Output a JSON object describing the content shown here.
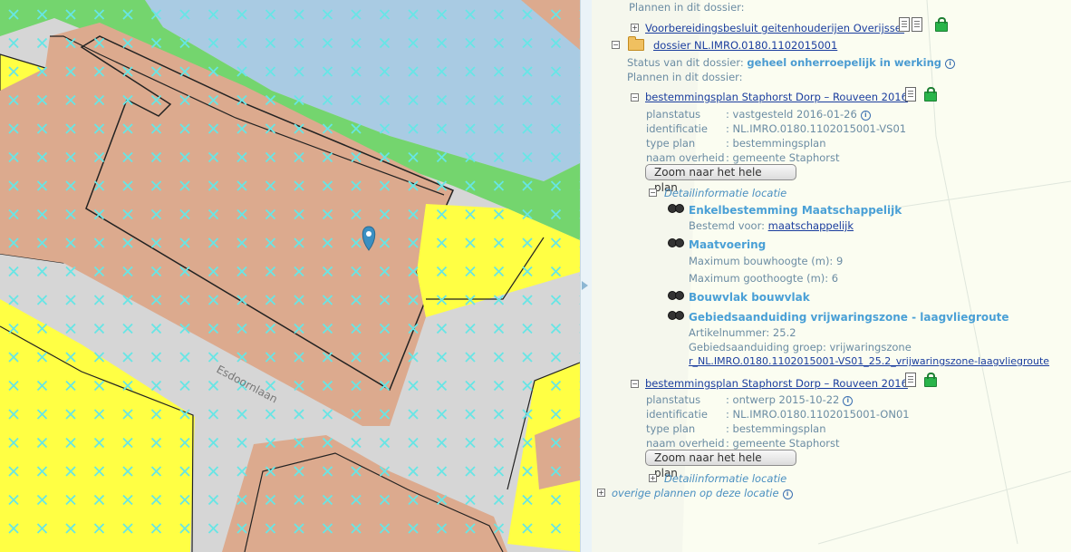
{
  "map": {
    "street_label": "Esdoornlaan",
    "colors": {
      "water": "#a9cbe3",
      "green": "#74d56e",
      "residential": "#ffff44",
      "societal": "#dcaa8e",
      "road": "#d6d6d6",
      "hatch": "#66e6e6",
      "marker": "#3a8fc2"
    }
  },
  "panel": {
    "prev_header": "Plannen in dit dossier:",
    "prev_plan_link": "Voorbereidingsbesluit geitenhouderijen Overijssel",
    "dossier_link": "dossier NL.IMRO.0180.1102015001",
    "status_label": "Status van dit dossier:",
    "status_value": "geheel onherroepelijk in werking",
    "plans_label": "Plannen in dit dossier:",
    "plan1": {
      "link": "bestemmingsplan Staphorst Dorp – Rouveen 2016",
      "rows": [
        {
          "label": "planstatus",
          "value": ": vastgesteld 2016-01-26"
        },
        {
          "label": "identificatie",
          "value": ": NL.IMRO.0180.1102015001-VS01"
        },
        {
          "label": "type plan",
          "value": ": bestemmingsplan"
        },
        {
          "label": "naam overheid",
          "value": ": gemeente Staphorst"
        }
      ],
      "zoom_button": "Zoom naar het hele plan",
      "detail_header": "Detailinformatie locatie",
      "e1_title": "Enkelbestemming Maatschappelijk",
      "e1_label": "Bestemd voor:",
      "e1_link": "maatschappelijk",
      "e2_title": "Maatvoering",
      "e2_l1": "Maximum bouwhoogte (m): 9",
      "e2_l2": "Maximum goothoogte (m): 6",
      "e3_title": "Bouwvlak bouwvlak",
      "e4_title": "Gebiedsaanduiding vrijwaringszone - laagvliegroute",
      "e4_l1": "Artikelnummer: 25.2",
      "e4_l2": "Gebiedsaanduiding groep: vrijwaringszone",
      "e4_link": "r_NL.IMRO.0180.1102015001-VS01_25.2_vrijwaringszone-laagvliegroute"
    },
    "plan2": {
      "link": "bestemmingsplan Staphorst Dorp – Rouveen 2016",
      "rows": [
        {
          "label": "planstatus",
          "value": ": ontwerp 2015-10-22"
        },
        {
          "label": "identificatie",
          "value": ": NL.IMRO.0180.1102015001-ON01"
        },
        {
          "label": "type plan",
          "value": ": bestemmingsplan"
        },
        {
          "label": "naam overheid",
          "value": ": gemeente Staphorst"
        }
      ],
      "zoom_button": "Zoom naar het hele plan",
      "detail_header": "Detailinformatie locatie"
    },
    "other_plans": "overige plannen op deze locatie"
  }
}
